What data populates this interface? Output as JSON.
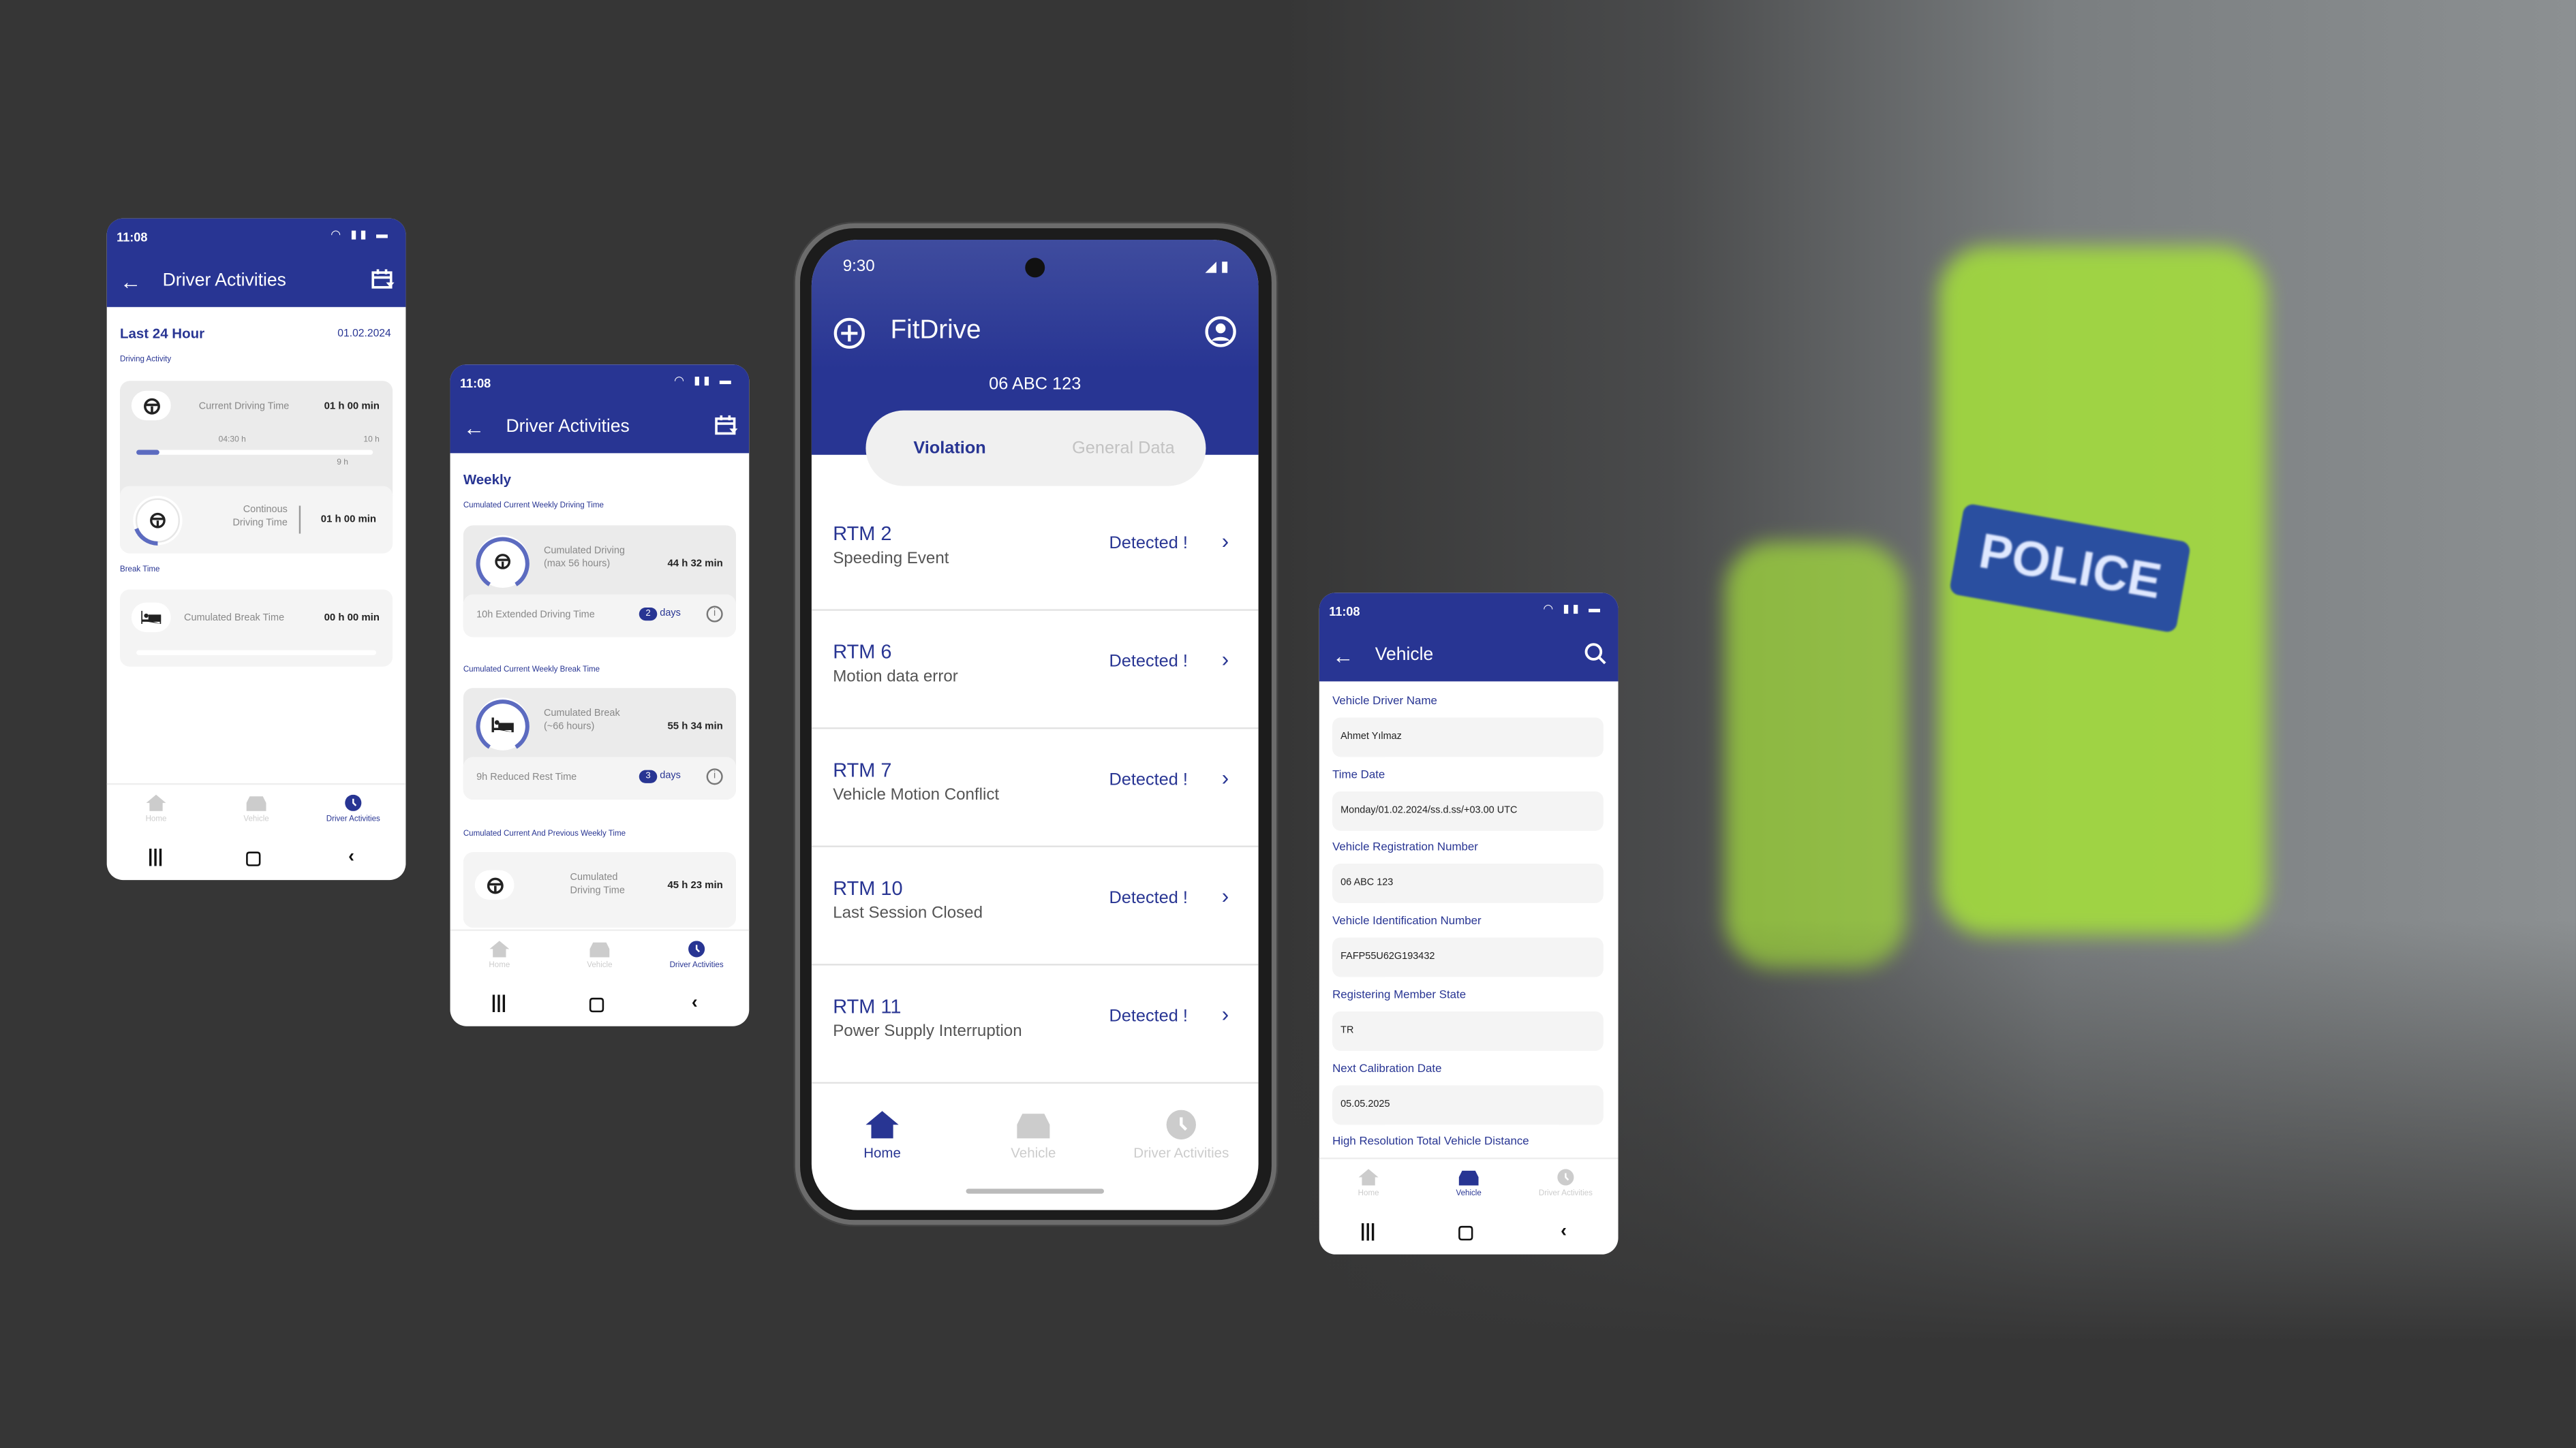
{
  "colors": {
    "primary": "#283593",
    "progress": "#5c6bc0",
    "card": "#ebebeb",
    "card_light": "#f4f4f4",
    "background": "#363636"
  },
  "photo": {
    "vest_text": "POLICE"
  },
  "phone_daily": {
    "status_time": "11:08",
    "title": "Driver Activities",
    "section": "Last 24 Hour",
    "date": "01.02.2024",
    "driving_activity_label": "Driving Activity",
    "current_driving_label": "Current Driving Time",
    "current_driving_value": "01 h 00 min",
    "progress": {
      "marks": [
        "04:30 h",
        "9 h",
        "10 h"
      ],
      "fraction": 0.1
    },
    "continuous_label_1": "Continous",
    "continuous_label_2": "Driving Time",
    "continuous_value": "01 h 00 min",
    "break_label": "Break Time",
    "cumulated_break_label": "Cumulated Break Time",
    "cumulated_break_value": "00 h 00 min",
    "nav": [
      "Home",
      "Vehicle",
      "Driver Activities"
    ],
    "active_nav": "Driver Activities"
  },
  "phone_weekly": {
    "status_time": "11:08",
    "title": "Driver Activities",
    "section": "Weekly",
    "driving_section": "Cumulated Current Weekly Driving Time",
    "driving_label_1": "Cumulated Driving",
    "driving_label_2": "(max 56 hours)",
    "driving_value": "44 h 32 min",
    "extended_label": "10h Extended Driving Time",
    "extended_count": "2",
    "extended_unit": "days",
    "break_section": "Cumulated Current Weekly Break Time",
    "break_label_1": "Cumulated Break",
    "break_label_2": "(~66 hours)",
    "break_value": "55 h 34 min",
    "reduced_label": "9h Reduced Rest Time",
    "reduced_count": "3",
    "reduced_unit": "days",
    "prev_section": "Cumulated Current And Previous Weekly Time",
    "prev_label_1": "Cumulated",
    "prev_label_2": "Driving Time",
    "prev_value": "45 h 23 min",
    "nav": [
      "Home",
      "Vehicle",
      "Driver Activities"
    ],
    "active_nav": "Driver Activities"
  },
  "phone_main": {
    "status_time": "9:30",
    "app_title": "FitDrive",
    "plate": "06 ABC 123",
    "tabs": [
      "Violation",
      "General Data"
    ],
    "active_tab": "Violation",
    "violations": [
      {
        "code": "RTM 2",
        "desc": "Speeding Event",
        "status": "Detected !"
      },
      {
        "code": "RTM 6",
        "desc": "Motion data error",
        "status": "Detected !"
      },
      {
        "code": "RTM 7",
        "desc": "Vehicle Motion Conflict",
        "status": "Detected !"
      },
      {
        "code": "RTM 10",
        "desc": "Last Session Closed",
        "status": "Detected !"
      },
      {
        "code": "RTM 11",
        "desc": "Power Supply Interruption",
        "status": "Detected !"
      }
    ],
    "nav": [
      "Home",
      "Vehicle",
      "Driver Activities"
    ],
    "active_nav": "Home"
  },
  "phone_vehicle": {
    "status_time": "11:08",
    "title": "Vehicle",
    "fields": [
      {
        "label": "Vehicle Driver Name",
        "value": "Ahmet Yılmaz"
      },
      {
        "label": "Time Date",
        "value": "Monday/01.02.2024/ss.d.ss/+03.00 UTC"
      },
      {
        "label": "Vehicle Registration Number",
        "value": "06 ABC 123"
      },
      {
        "label": "Vehicle Identification Number",
        "value": "FAFP55U62G193432"
      },
      {
        "label": "Registering Member State",
        "value": "TR"
      },
      {
        "label": "Next Calibration Date",
        "value": "05.05.2025"
      },
      {
        "label": "High Resolution Total Vehicle Distance",
        "value": ""
      }
    ],
    "nav": [
      "Home",
      "Vehicle",
      "Driver Activities"
    ],
    "active_nav": "Vehicle"
  }
}
